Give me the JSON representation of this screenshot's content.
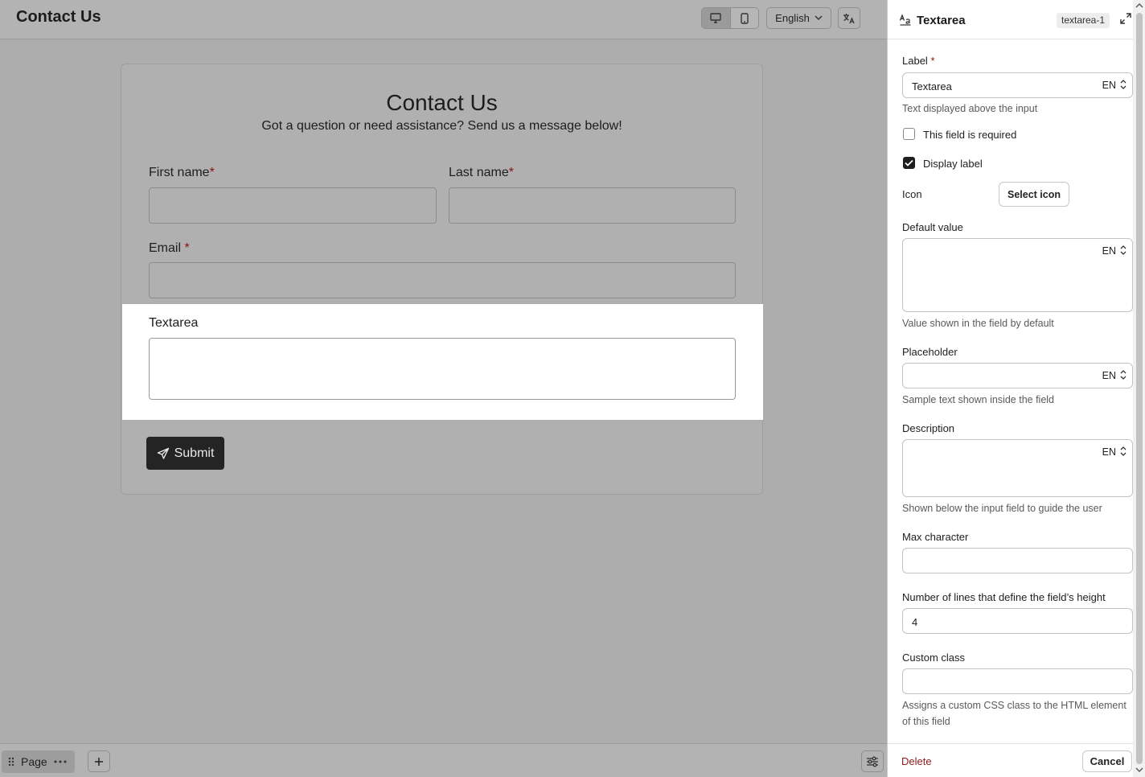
{
  "topbar": {
    "title": "Contact Us",
    "language": "English"
  },
  "form": {
    "heading": "Contact Us",
    "subheading": "Got a question or need assistance? Send us a message below!",
    "first_name_label": "First name",
    "last_name_label": "Last name",
    "email_label": "Email",
    "required_mark": "*",
    "textarea_label": "Textarea",
    "submit_label": "Submit"
  },
  "bottombar": {
    "page_label": "Page"
  },
  "panel": {
    "title": "Textarea",
    "id_badge": "textarea-1",
    "label_label": "Label",
    "required_mark": "*",
    "label_value": "Textarea",
    "lang_code": "EN",
    "label_help": "Text displayed above the input",
    "required_checkbox_label": "This field is required",
    "required_checked": false,
    "display_label_checkbox_label": "Display label",
    "display_label_checked": true,
    "icon_label": "Icon",
    "select_icon_button": "Select icon",
    "default_value_label": "Default value",
    "default_value_help": "Value shown in the field by default",
    "placeholder_label": "Placeholder",
    "placeholder_help": "Sample text shown inside the field",
    "description_label": "Description",
    "description_help": "Shown below the input field to guide the user",
    "max_character_label": "Max character",
    "lines_label": "Number of lines that define the field’s height",
    "lines_value": "4",
    "custom_class_label": "Custom class",
    "custom_class_help_line1": "Assigns a custom CSS class to the HTML element",
    "custom_class_help_line2": "of this field",
    "delete_label": "Delete",
    "cancel_label": "Cancel"
  },
  "icons": [
    "desktop-icon",
    "mobile-icon",
    "chevron-down-icon",
    "translate-icon",
    "drag-handle-icon",
    "more-icon",
    "plus-icon",
    "sliders-icon",
    "send-icon",
    "text-field-icon",
    "expand-icon",
    "sort-chevrons-icon",
    "check-icon"
  ],
  "colors": {
    "accent_dark": "#242424",
    "required_red": "#8a1010",
    "delete_red": "#8a1a1a"
  }
}
